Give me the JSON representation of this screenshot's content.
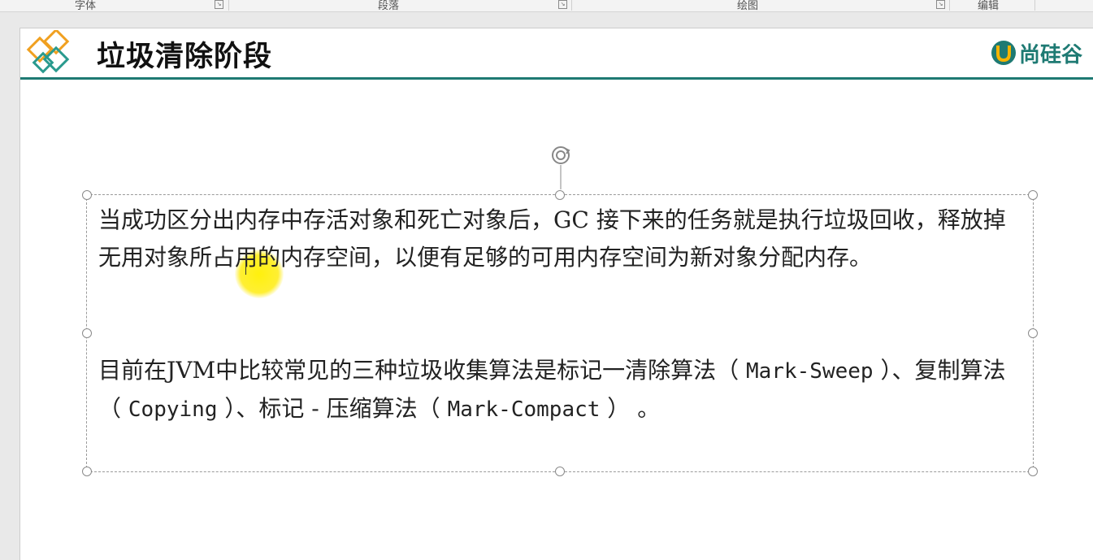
{
  "ribbon": {
    "groups": [
      "字体",
      "段落",
      "绘图",
      "编辑"
    ]
  },
  "slide": {
    "title": "垃圾清除阶段",
    "brand": "尚硅谷",
    "accent_color": "#1e7a73",
    "paragraph1": "当成功区分出内存中存活对象和死亡对象后，GC 接下来的任务就是执行垃圾回收，释放掉无用对象所占用的内存空间，以便有足够的可用内存空间为新对象分配内存。",
    "paragraph2": {
      "t1": "目前在JVM中比较常见的三种垃圾收集算法是标记一清除算法（ ",
      "t2": "Mark-Sweep",
      "t3": " ）、复制算法（ ",
      "t4": "Copying",
      "t5": " ）、标记 - 压缩算法（ ",
      "t6": "Mark-Compact",
      "t7": " ） 。"
    }
  },
  "icons": [
    "logo-diamonds-icon",
    "brand-u-icon",
    "rotate-icon"
  ]
}
